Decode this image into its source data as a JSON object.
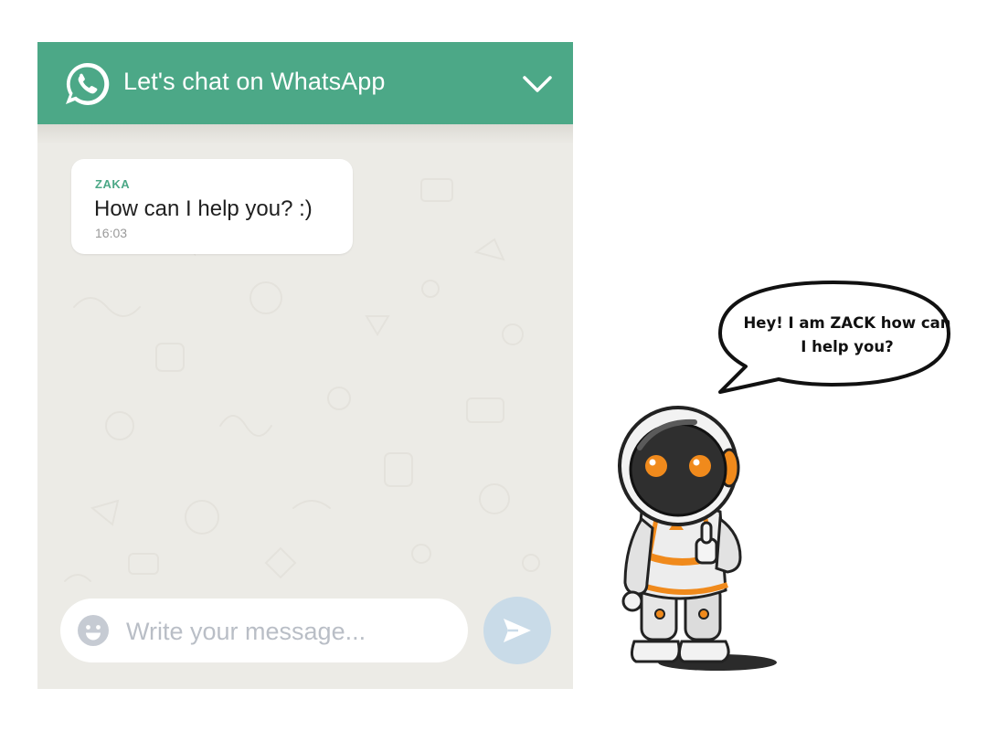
{
  "header": {
    "title": "Let's chat on WhatsApp",
    "logo_icon": "whatsapp-icon",
    "collapse_icon": "chevron-down-icon"
  },
  "messages": [
    {
      "sender": "ZAKA",
      "text": "How can I help you? :)",
      "time": "16:03"
    }
  ],
  "composer": {
    "placeholder": "Write your message...",
    "emoji_icon": "emoji-icon",
    "send_icon": "send-icon"
  },
  "mascot": {
    "speech": "Hey! I am ZACK how can I help you?"
  },
  "colors": {
    "header": "#4ca887",
    "chat_background": "#ecebe6",
    "send_button": "#c9dbe8",
    "mascot_accent": "#f08a1c"
  }
}
